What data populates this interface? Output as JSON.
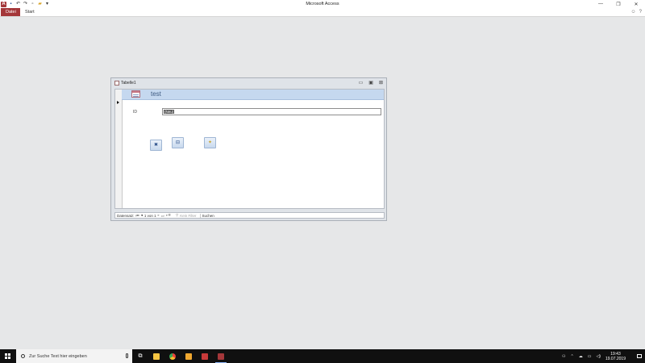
{
  "window": {
    "app_title": "Microsoft Access",
    "controls": [
      "—",
      "❐",
      "✕"
    ]
  },
  "quick_access": {
    "logo": "A",
    "icons": [
      "save-icon",
      "undo-icon",
      "redo-icon",
      "new-icon",
      "open-icon",
      "customize-icon"
    ]
  },
  "ribbon": {
    "tabs": [
      "Datei",
      "Start"
    ],
    "right_icons": [
      "☺",
      "?"
    ]
  },
  "form_window": {
    "title": "Tabelle1",
    "controls": [
      "▭",
      "▣",
      "⊠"
    ],
    "header_title": "test",
    "id_label": "ID",
    "id_value": "(Neu)",
    "buttons": [
      {
        "name": "delete-record-button",
        "glyph": "✖"
      },
      {
        "name": "save-record-button",
        "glyph": "⊟"
      },
      {
        "name": "new-record-button",
        "glyph": "✦"
      }
    ]
  },
  "navigation": {
    "label": "Datensatz:",
    "first": "⏮",
    "prev": "◂",
    "position": "1 von 1",
    "next": "▸",
    "last": "⏭",
    "new": "▸✱",
    "filter_icon": "⚲",
    "filter": "Kein Filter",
    "search": "Suchen"
  },
  "taskbar": {
    "search_placeholder": "Zur Suche Text hier eingeben",
    "apps": [
      {
        "name": "task-view-icon",
        "color": "#101010"
      },
      {
        "name": "file-explorer-icon",
        "color": "#f5c542"
      },
      {
        "name": "chrome-icon",
        "color": "#e8453c"
      },
      {
        "name": "folder-icon",
        "color": "#f0a830"
      },
      {
        "name": "word-icon",
        "color": "#c83a3a"
      },
      {
        "name": "access-icon",
        "color": "#a4373a"
      }
    ],
    "time": "19:43",
    "date": "19.07.2019"
  }
}
